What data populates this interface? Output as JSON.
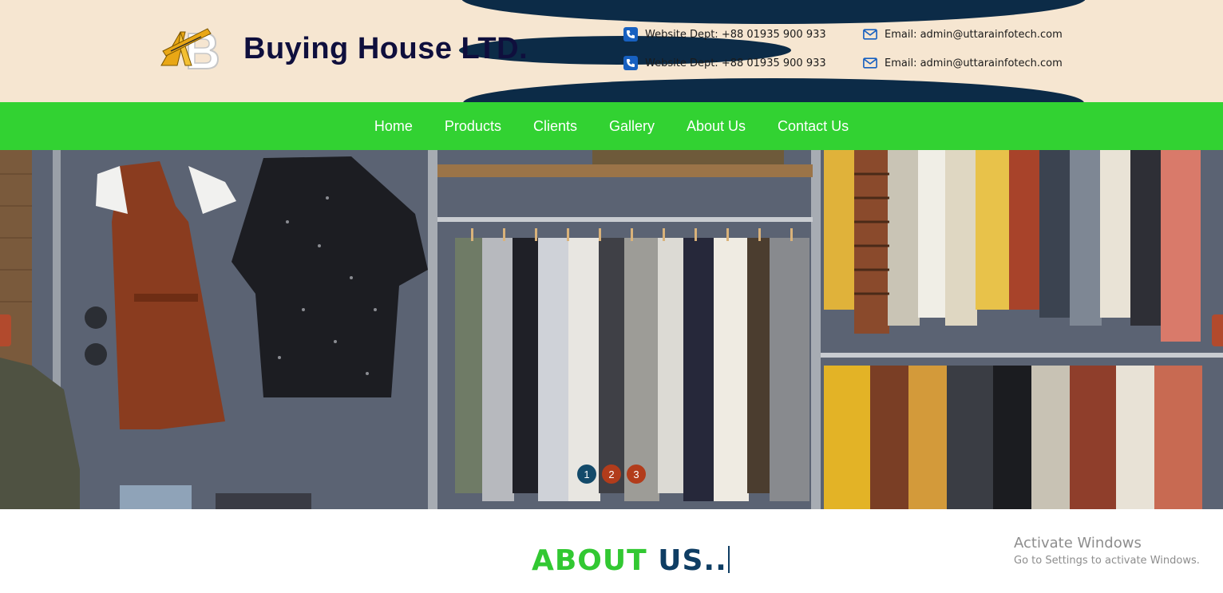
{
  "header": {
    "brand": "Buying House LTD.",
    "contacts": [
      {
        "icon": "phone-icon",
        "text": "Website Dept: +88 01935 900 933"
      },
      {
        "icon": "phone-icon",
        "text": "Website Dept: +88 01935 900 933"
      },
      {
        "icon": "envelope-icon",
        "text": "Email: admin@uttarainfotech.com"
      },
      {
        "icon": "envelope-icon",
        "text": "Email: admin@uttarainfotech.com"
      }
    ]
  },
  "nav": {
    "items": [
      "Home",
      "Products",
      "Clients",
      "Gallery",
      "About Us",
      "Contact Us"
    ]
  },
  "slider": {
    "dots": [
      "1",
      "2",
      "3"
    ],
    "active_index": 0
  },
  "about": {
    "word1": "ABOUT",
    "word2": "US.."
  },
  "watermark": {
    "line1": "Activate Windows",
    "line2": "Go to Settings to activate Windows."
  },
  "colors": {
    "header_bg": "#f6e6d1",
    "nav_bg": "#32d232",
    "accent_green": "#32c832",
    "accent_navy": "#0e3d63",
    "dot_active": "#134a6a",
    "dot_inactive": "#b23c1b"
  }
}
